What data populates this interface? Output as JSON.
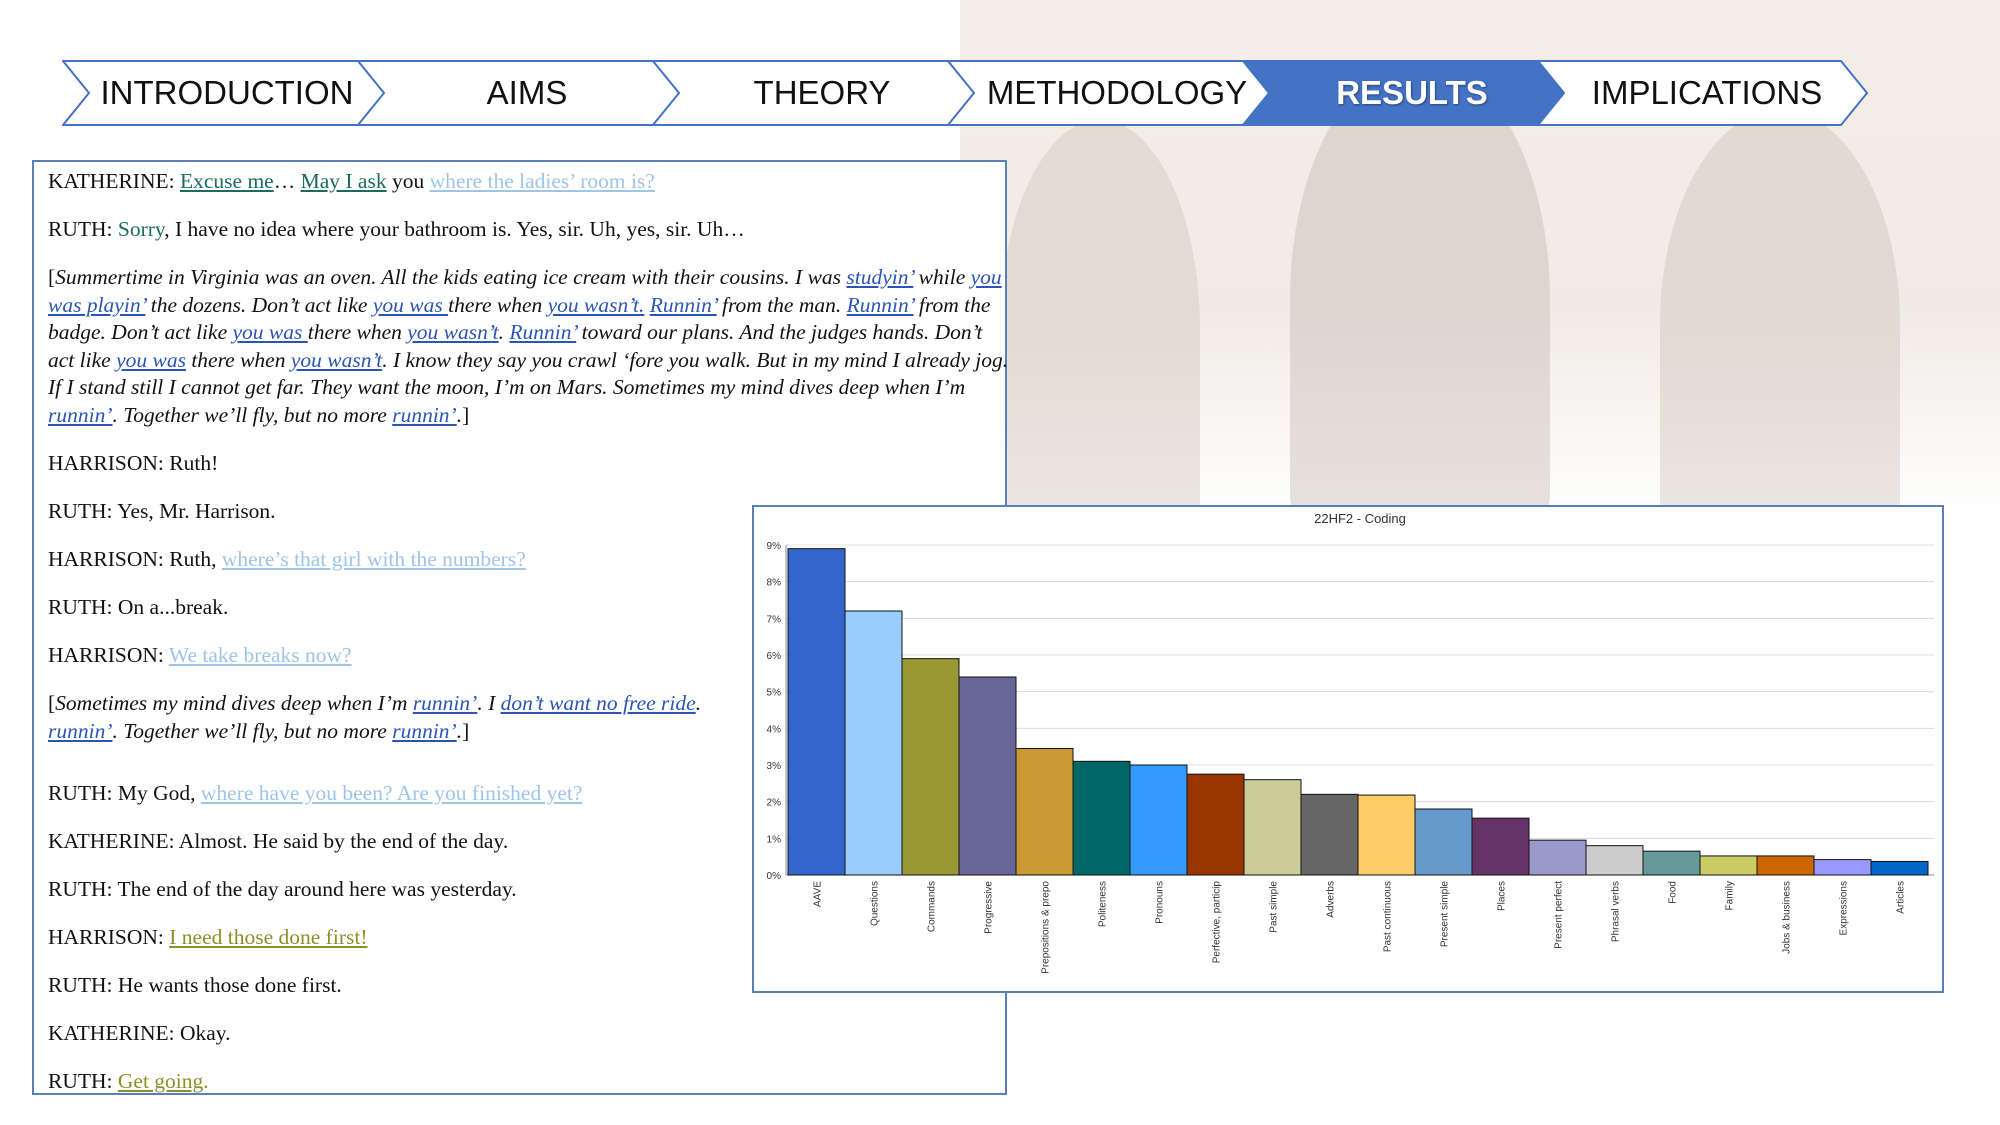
{
  "nav": {
    "items": [
      {
        "label": "INTRODUCTION",
        "active": false
      },
      {
        "label": "AIMS",
        "active": false
      },
      {
        "label": "THEORY",
        "active": false
      },
      {
        "label": "METHODOLOGY",
        "active": false
      },
      {
        "label": "RESULTS",
        "active": true
      },
      {
        "label": "IMPLICATIONS",
        "active": false
      }
    ],
    "colors": {
      "active": "#4472c4",
      "inactive": "#ffffff",
      "border": "#4472c4"
    }
  },
  "transcript": {
    "l1": {
      "speaker": "KATHERINE: ",
      "a": "Excuse me",
      "b": "… ",
      "c": "May I ask",
      "d": " you ",
      "e": "where the ladies’ room is?"
    },
    "l2": {
      "speaker": "RUTH: ",
      "a": "Sorry",
      "b": ", I have no idea where your bathroom is. Yes, sir. Uh, yes, sir. Uh…"
    },
    "p1": {
      "s1": "Summertime in Virginia was an oven. All the kids eating ice cream with their cousins. I was ",
      "u1": "studyin’",
      "s2": " while ",
      "u2": "you was playin’",
      "s3": " the dozens. Don’t act like ",
      "u3": "you was ",
      "s4": "there when ",
      "u4": "you wasn’t.",
      "s5": " ",
      "u5": "Runnin’",
      "s6": " from the man. ",
      "u6": "Runnin’",
      "s7": " from the badge. Don’t act like ",
      "u7": "you was ",
      "s8": "there when ",
      "u8": "you wasn’t",
      "s9": ". ",
      "u9": "Runnin’",
      "s10": " toward our plans. And the judges hands. Don’t act like ",
      "u10": "you was",
      "s11": " there when ",
      "u11": "you wasn’t",
      "s12": ". I know they say you crawl ‘fore you walk. But in my mind I already jog. If I stand still I cannot get far. They want the moon, I’m on Mars. Sometimes my mind dives deep when I’m ",
      "u12": "runnin’",
      "s13": ". Together we’ll fly, but no more ",
      "u13": "runnin’",
      "s14": ".",
      "open": "[",
      "close": "]"
    },
    "l3": {
      "speaker": "HARRISON: ",
      "a": "Ruth!"
    },
    "l4": {
      "speaker": "RUTH: ",
      "a": "Yes, Mr. Harrison."
    },
    "l5": {
      "speaker": "HARRISON: ",
      "a": "Ruth, ",
      "b": "where’s that girl with the numbers? "
    },
    "l6": {
      "speaker": "RUTH: ",
      "a": "On a...break."
    },
    "l7": {
      "speaker": "HARRISON: ",
      "a": "We take breaks now?"
    },
    "p2": {
      "open": "[",
      "s1": "Sometimes my mind dives deep when I’m ",
      "u1": "runnin’",
      "s2": ". I ",
      "u2": "don’t want no free ride",
      "s3": ".",
      "u3": "runnin’",
      "s4": ". Together we’ll fly, but no more ",
      "u4": "runnin’",
      "s5": ".",
      "close": "]"
    },
    "l8": {
      "speaker": "RUTH: ",
      "a": "My God, ",
      "b": "where have you been? Are you finished  yet?"
    },
    "l9": {
      "speaker": "KATHERINE: ",
      "a": "Almost. He said by the end of the day."
    },
    "l10": {
      "speaker": "RUTH: ",
      "a": "The end of the day around here was yesterday."
    },
    "l11": {
      "speaker": "HARRISON: ",
      "a": "I need those done first!"
    },
    "l12": {
      "speaker": "RUTH: ",
      "a": "He wants those done first."
    },
    "l13": {
      "speaker": "KATHERINE: ",
      "a": "Okay."
    },
    "l14": {
      "speaker": "RUTH: ",
      "a": "Get going",
      "b": "."
    }
  },
  "chart_data": {
    "type": "bar",
    "title": "22HF2 - Coding",
    "xlabel": "",
    "ylabel": "",
    "ylim": [
      0,
      9
    ],
    "ytick_labels": [
      "0%",
      "1%",
      "2%",
      "3%",
      "4%",
      "5%",
      "6%",
      "7%",
      "8%",
      "9%"
    ],
    "grid": true,
    "categories": [
      "AAVE",
      "Questions",
      "Commands",
      "Progressive",
      "Prepositions & prepo",
      "Politeness",
      "Pronouns",
      "Perfective, particip",
      "Past simple",
      "Adverbs",
      "Past continuous",
      "Present simple",
      "Places",
      "Present perfect",
      "Phrasal verbs",
      "Food",
      "Family",
      "Jobs & business",
      "Expressions",
      "Articles"
    ],
    "values": [
      8.9,
      7.2,
      5.9,
      5.4,
      3.45,
      3.1,
      3.0,
      2.75,
      2.6,
      2.2,
      2.18,
      1.8,
      1.55,
      0.95,
      0.8,
      0.65,
      0.52,
      0.52,
      0.42,
      0.37
    ],
    "colors": [
      "#3366cc",
      "#99ccff",
      "#999933",
      "#666699",
      "#cc9933",
      "#006666",
      "#3399ff",
      "#993300",
      "#cccc99",
      "#666666",
      "#ffcc66",
      "#6699cc",
      "#663366",
      "#9999cc",
      "#cccccc",
      "#669999",
      "#cccc66",
      "#cc6600",
      "#9999ff",
      "#0066cc"
    ]
  }
}
